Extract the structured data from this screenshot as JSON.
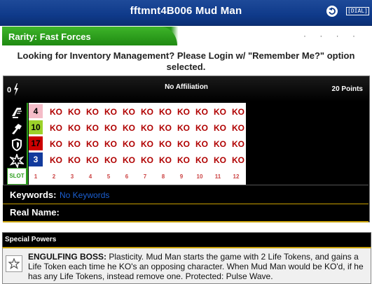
{
  "title": "fftmnt4B006 Mud Man",
  "title_actions": {
    "dial_label": "[DIAL]"
  },
  "rarity": {
    "label": "Rarity: Fast Forces",
    "dots": "· · · ·"
  },
  "login_message": "Looking for Inventory Management? Please Login w/ \"Remember Me?\" option selected.",
  "card": {
    "cost": "0",
    "affiliation": "No Affiliation",
    "points": "20 Points",
    "slot_label": "SLOT",
    "stat_icons": [
      "speed-boot-icon",
      "attack-fist-icon",
      "defense-shield-icon",
      "damage-starburst-icon"
    ],
    "rows": [
      {
        "value": "4",
        "value_bg": "#f4bcc8",
        "value_color": "#000000",
        "clicks": [
          "KO",
          "KO",
          "KO",
          "KO",
          "KO",
          "KO",
          "KO",
          "KO",
          "KO",
          "KO",
          "KO"
        ]
      },
      {
        "value": "10",
        "value_bg": "#9cd22a",
        "value_color": "#000000",
        "clicks": [
          "KO",
          "KO",
          "KO",
          "KO",
          "KO",
          "KO",
          "KO",
          "KO",
          "KO",
          "KO",
          "KO"
        ]
      },
      {
        "value": "17",
        "value_bg": "#cc0000",
        "value_color": "#000000",
        "clicks": [
          "KO",
          "KO",
          "KO",
          "KO",
          "KO",
          "KO",
          "KO",
          "KO",
          "KO",
          "KO",
          "KO"
        ]
      },
      {
        "value": "3",
        "value_bg": "#123a9c",
        "value_color": "#ffffff",
        "clicks": [
          "KO",
          "KO",
          "KO",
          "KO",
          "KO",
          "KO",
          "KO",
          "KO",
          "KO",
          "KO",
          "KO"
        ]
      }
    ],
    "click_numbers": [
      "1",
      "2",
      "3",
      "4",
      "5",
      "6",
      "7",
      "8",
      "9",
      "10",
      "11",
      "12"
    ]
  },
  "keywords": {
    "label": "Keywords:",
    "value": "No Keywords"
  },
  "real_name": {
    "label": "Real Name:",
    "value": ""
  },
  "special_powers": {
    "header": "Special Powers",
    "items": [
      {
        "icon": "star-icon",
        "name": "ENGULFING BOSS:",
        "text": " Plasticity. Mud Man starts the game with 2 Life Tokens, and gains a Life Token each time he KO's an opposing character. When Mud Man would be KO'd, if he has any Life Tokens, instead remove one. Protected: Pulse Wave."
      }
    ]
  },
  "colors": {
    "title_bar": "#0f3a8a",
    "rarity_green": "#2e9e1e",
    "ko_red": "#b00000",
    "gold_rule": "#c8a000"
  }
}
